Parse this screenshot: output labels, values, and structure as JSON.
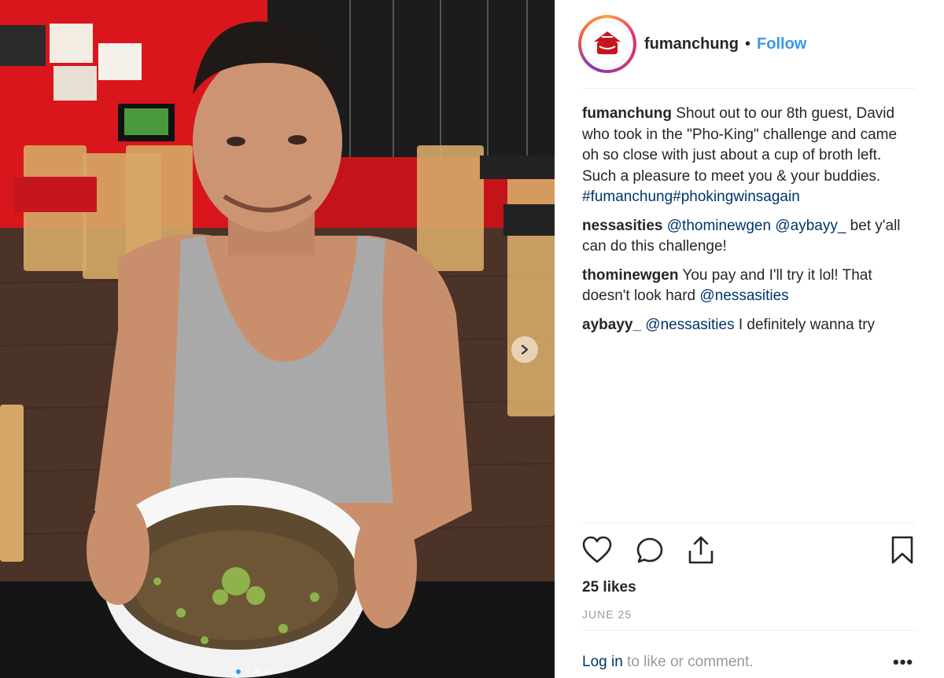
{
  "post": {
    "image": {
      "description_icon": "photo-man-with-pho-bowl",
      "carousel_dots": 4,
      "active_dot": 0
    },
    "header": {
      "username": "fumanchung",
      "bullet": "•",
      "follow_label": "Follow"
    },
    "comments": [
      {
        "user": "fumanchung",
        "parts": [
          {
            "text": " Shout out to our 8th guest, David who took in the \"Pho-King\" challenge and came oh so close with just about a cup of broth left. Such a pleasure to meet you & your buddies. "
          },
          {
            "text": "#fumanchung#phokingwinsagain",
            "mention": true
          }
        ]
      },
      {
        "user": "nessasities",
        "parts": [
          {
            "text": " "
          },
          {
            "text": "@thominewgen",
            "mention": true
          },
          {
            "text": " "
          },
          {
            "text": "@aybayy_",
            "mention": true
          },
          {
            "text": " bet y'all can do this challenge!"
          }
        ]
      },
      {
        "user": "thominewgen",
        "parts": [
          {
            "text": " You pay and I'll try it lol! That doesn't look hard "
          },
          {
            "text": "@nessasities",
            "mention": true
          }
        ]
      },
      {
        "user": "aybayy_",
        "parts": [
          {
            "text": " "
          },
          {
            "text": "@nessasities",
            "mention": true
          },
          {
            "text": " I definitely wanna try"
          }
        ]
      }
    ],
    "actions": {
      "like_icon": "heart-icon",
      "comment_icon": "comment-icon",
      "share_icon": "share-icon",
      "save_icon": "bookmark-icon"
    },
    "likes": "25 likes",
    "date": "JUNE 25",
    "footer": {
      "login_link": "Log in",
      "login_text": " to like or comment.",
      "more": "•••"
    }
  },
  "colors": {
    "accent": "#3897f0",
    "mention": "#003569",
    "muted": "#999999",
    "text": "#262626"
  }
}
